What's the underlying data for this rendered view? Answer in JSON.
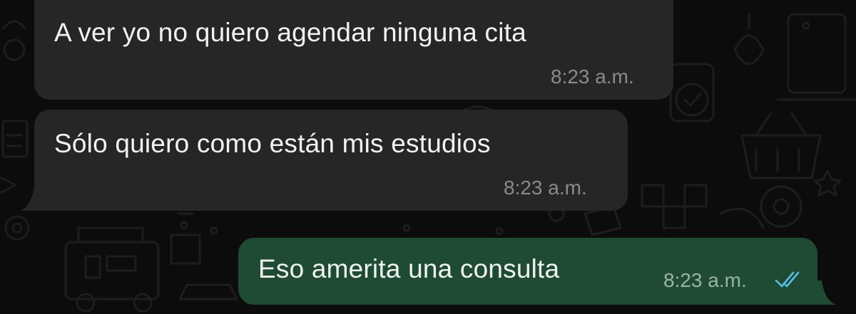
{
  "messages": [
    {
      "direction": "incoming",
      "text": "A ver yo no quiero agendar ninguna cita",
      "time": "8:23 a.m."
    },
    {
      "direction": "incoming",
      "text": "Sólo quiero como están mis estudios",
      "time": "8:23 a.m."
    },
    {
      "direction": "outgoing",
      "text": "Eso amerita una consulta",
      "time": "8:23 a.m.",
      "status_icon": "double-check-icon",
      "status_color": "#53bdeb"
    }
  ],
  "colors": {
    "background": "#0c0c0c",
    "incoming_bubble": "#262626",
    "outgoing_bubble": "#1f4a33",
    "read_ticks": "#53bdeb"
  }
}
